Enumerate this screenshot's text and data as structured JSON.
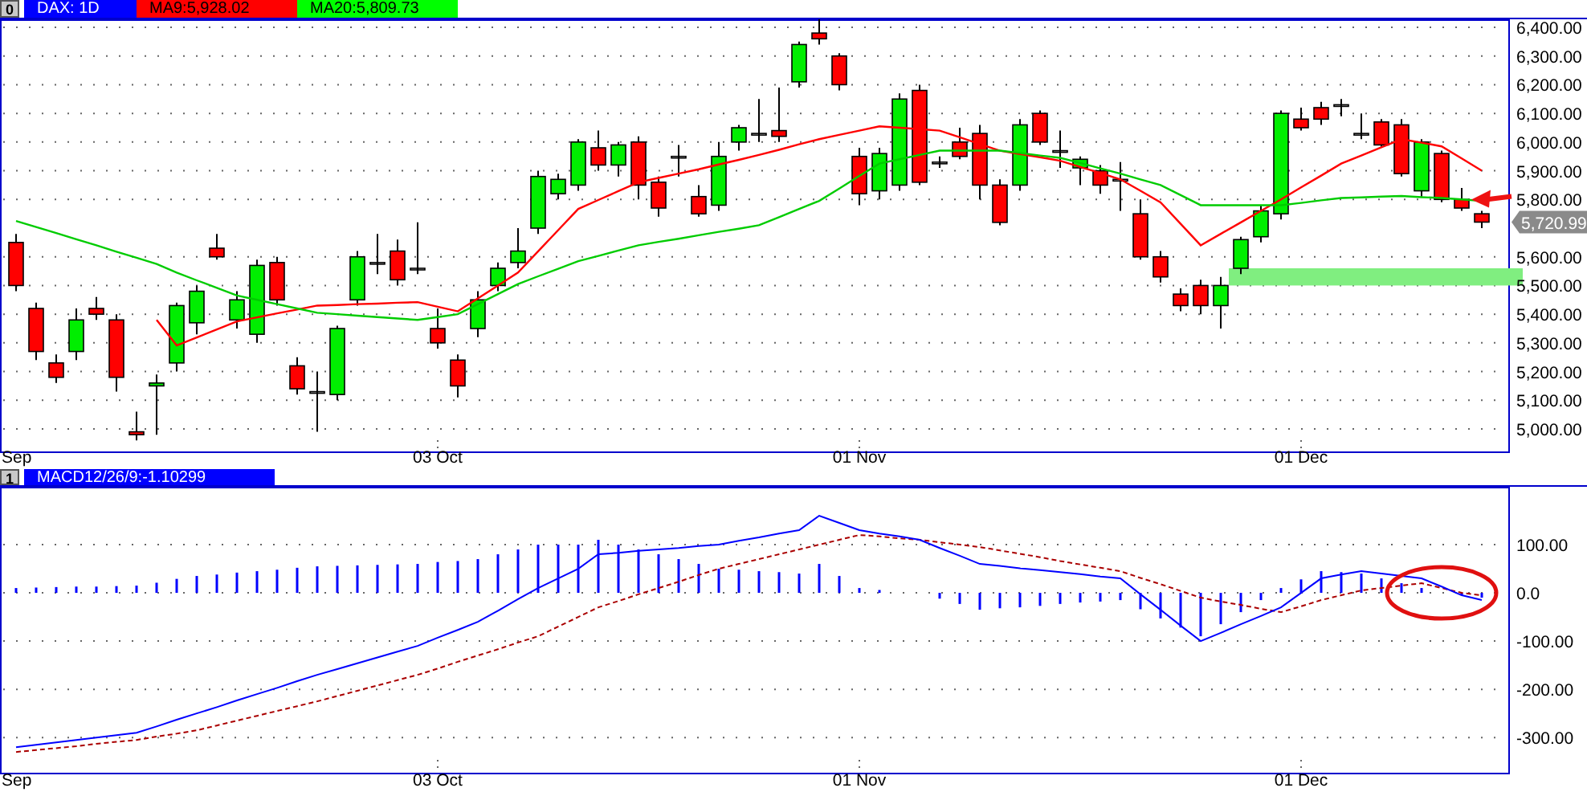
{
  "price_panel": {
    "index": "0",
    "legend": [
      {
        "label": "DAX: 1D",
        "color": "#0000ff"
      },
      {
        "label": "MA9:5,928.02",
        "color": "#ff0000"
      },
      {
        "label": "MA20:5,809.73",
        "color": "#00ff00"
      }
    ],
    "chart_data": {
      "type": "candlestick",
      "categories": [
        "Sep",
        null,
        null,
        null,
        null,
        null,
        null,
        null,
        null,
        null,
        null,
        null,
        null,
        null,
        null,
        null,
        null,
        null,
        null,
        null,
        null,
        "03 Oct",
        null,
        null,
        null,
        null,
        null,
        null,
        null,
        null,
        null,
        null,
        null,
        null,
        null,
        null,
        null,
        null,
        null,
        null,
        null,
        null,
        "01 Nov",
        null,
        null,
        null,
        null,
        null,
        null,
        null,
        null,
        null,
        null,
        null,
        null,
        null,
        null,
        null,
        null,
        null,
        null,
        null,
        null,
        null,
        "01 Dec",
        null,
        null,
        null,
        null,
        null,
        null,
        null,
        null,
        null
      ],
      "ylim": [
        4916,
        6428
      ],
      "grid": true,
      "yticks": [
        {
          "value": 6400,
          "label": "6,400.00"
        },
        {
          "value": 6300,
          "label": "6,300.00"
        },
        {
          "value": 6200,
          "label": "6,200.00"
        },
        {
          "value": 6100,
          "label": "6,100.00"
        },
        {
          "value": 6000,
          "label": "6,000.00"
        },
        {
          "value": 5900,
          "label": "5,900.00"
        },
        {
          "value": 5800,
          "label": "5,800.00"
        },
        {
          "value": 5600,
          "label": "5,600.00"
        },
        {
          "value": 5500,
          "label": "5,500.00"
        },
        {
          "value": 5400,
          "label": "5,400.00"
        },
        {
          "value": 5300,
          "label": "5,300.00"
        },
        {
          "value": 5200,
          "label": "5,200.00"
        },
        {
          "value": 5100,
          "label": "5,100.00"
        },
        {
          "value": 5000,
          "label": "5,000.00"
        }
      ],
      "ohlc": [
        [
          5650,
          5680,
          5480,
          5500
        ],
        [
          5420,
          5440,
          5240,
          5270
        ],
        [
          5230,
          5260,
          5160,
          5180
        ],
        [
          5270,
          5420,
          5240,
          5380
        ],
        [
          5420,
          5460,
          5380,
          5400
        ],
        [
          5380,
          5400,
          5130,
          5180
        ],
        [
          4990,
          5060,
          4960,
          4980
        ],
        [
          5150,
          5190,
          4980,
          5160
        ],
        [
          5230,
          5440,
          5200,
          5430
        ],
        [
          5370,
          5500,
          5330,
          5480
        ],
        [
          5630,
          5680,
          5590,
          5600
        ],
        [
          5380,
          5480,
          5350,
          5450
        ],
        [
          5330,
          5590,
          5300,
          5570
        ],
        [
          5580,
          5600,
          5430,
          5450
        ],
        [
          5220,
          5250,
          5120,
          5140
        ],
        [
          5130,
          5200,
          4990,
          5130
        ],
        [
          5120,
          5360,
          5100,
          5350
        ],
        [
          5450,
          5620,
          5430,
          5600
        ],
        [
          5580,
          5680,
          5540,
          5580
        ],
        [
          5620,
          5660,
          5500,
          5520
        ],
        [
          5560,
          5720,
          5540,
          5560
        ],
        [
          5350,
          5420,
          5280,
          5300
        ],
        [
          5240,
          5260,
          5110,
          5150
        ],
        [
          5350,
          5480,
          5320,
          5450
        ],
        [
          5500,
          5580,
          5480,
          5560
        ],
        [
          5580,
          5700,
          5560,
          5620
        ],
        [
          5700,
          5900,
          5680,
          5880
        ],
        [
          5820,
          5890,
          5800,
          5870
        ],
        [
          5850,
          6010,
          5830,
          6000
        ],
        [
          5980,
          6040,
          5900,
          5920
        ],
        [
          5920,
          6000,
          5880,
          5990
        ],
        [
          6000,
          6020,
          5800,
          5850
        ],
        [
          5860,
          5880,
          5740,
          5770
        ],
        [
          5950,
          5990,
          5880,
          5950
        ],
        [
          5810,
          5850,
          5740,
          5750
        ],
        [
          5780,
          6000,
          5760,
          5950
        ],
        [
          6000,
          6060,
          5970,
          6050
        ],
        [
          6030,
          6150,
          6000,
          6030
        ],
        [
          6040,
          6190,
          6000,
          6020
        ],
        [
          6210,
          6350,
          6190,
          6340
        ],
        [
          6380,
          6430,
          6340,
          6360
        ],
        [
          6300,
          6310,
          6180,
          6200
        ],
        [
          5950,
          5980,
          5780,
          5820
        ],
        [
          5830,
          5980,
          5800,
          5960
        ],
        [
          5850,
          6170,
          5830,
          6150
        ],
        [
          6180,
          6200,
          5850,
          5860
        ],
        [
          5930,
          5950,
          5910,
          5930
        ],
        [
          6000,
          6050,
          5940,
          5950
        ],
        [
          6030,
          6060,
          5800,
          5850
        ],
        [
          5850,
          5870,
          5710,
          5720
        ],
        [
          5850,
          6080,
          5830,
          6060
        ],
        [
          6100,
          6110,
          5990,
          6000
        ],
        [
          5970,
          6040,
          5910,
          5970
        ],
        [
          5910,
          5950,
          5850,
          5940
        ],
        [
          5900,
          5920,
          5820,
          5850
        ],
        [
          5870,
          5930,
          5760,
          5870
        ],
        [
          5750,
          5800,
          5590,
          5600
        ],
        [
          5600,
          5620,
          5510,
          5530
        ],
        [
          5470,
          5490,
          5410,
          5430
        ],
        [
          5500,
          5520,
          5400,
          5430
        ],
        [
          5430,
          5530,
          5350,
          5500
        ],
        [
          5560,
          5670,
          5540,
          5660
        ],
        [
          5670,
          5780,
          5650,
          5760
        ],
        [
          5750,
          6110,
          5730,
          6100
        ],
        [
          6080,
          6120,
          6040,
          6050
        ],
        [
          6120,
          6140,
          6060,
          6080
        ],
        [
          6130,
          6150,
          6090,
          6130
        ],
        [
          6030,
          6100,
          6010,
          6030
        ],
        [
          6070,
          6080,
          5980,
          5990
        ],
        [
          6060,
          6080,
          5880,
          5890
        ],
        [
          5830,
          6010,
          5810,
          6000
        ],
        [
          5960,
          5970,
          5790,
          5800
        ],
        [
          5800,
          5840,
          5760,
          5770
        ],
        [
          5750,
          5760,
          5700,
          5720.99
        ]
      ],
      "series": [
        {
          "type": "line",
          "color": "#ff0000",
          "values": [
            null,
            null,
            null,
            null,
            null,
            null,
            null,
            5380,
            5291,
            5319,
            5347,
            5375,
            5389,
            5403,
            5416,
            5430,
            5432,
            5435,
            5437,
            5440,
            5442,
            5426,
            5410,
            5455,
            5500,
            5545,
            5619,
            5693,
            5767,
            5798,
            5829,
            5860,
            5875,
            5890,
            5905,
            5922,
            5938,
            5955,
            5973,
            5992,
            6010,
            6025,
            6040,
            6055,
            6050,
            6045,
            6040,
            6017,
            5993,
            5970,
            5958,
            5947,
            5935,
            5913,
            5892,
            5870,
            5830,
            5790,
            5715,
            5640,
            5680,
            5720,
            5760,
            5800,
            5842,
            5883,
            5925,
            5953,
            5982,
            6010,
            5998,
            5985,
            5943,
            5900
          ]
        },
        {
          "type": "line",
          "color": "#00cc00",
          "values": [
            5725,
            5704,
            5683,
            5661,
            5640,
            5618,
            5597,
            5575,
            5545,
            5518,
            5492,
            5465,
            5450,
            5435,
            5420,
            5405,
            5400,
            5395,
            5390,
            5385,
            5380,
            5390,
            5400,
            5435,
            5470,
            5505,
            5532,
            5558,
            5585,
            5603,
            5622,
            5640,
            5652,
            5663,
            5675,
            5687,
            5698,
            5710,
            5738,
            5767,
            5795,
            5838,
            5882,
            5925,
            5940,
            5955,
            5970,
            5970,
            5970,
            5970,
            5962,
            5953,
            5945,
            5927,
            5908,
            5890,
            5870,
            5850,
            5815,
            5780,
            5780,
            5780,
            5780,
            5780,
            5788,
            5797,
            5805,
            5807,
            5810,
            5812,
            5808,
            5805,
            5800,
            5795
          ]
        }
      ],
      "bands": [
        {
          "axis": "y",
          "from": 5500,
          "to": 5560
        }
      ],
      "annotations": [
        "5,720.99"
      ]
    }
  },
  "macd_panel": {
    "index": "1",
    "legend": [
      {
        "label": "MACD12/26/9:-1.10299",
        "color": "#0000ff"
      }
    ],
    "chart_data": {
      "type": "line",
      "categories": [
        "Sep",
        null,
        null,
        null,
        null,
        null,
        null,
        null,
        null,
        null,
        null,
        null,
        null,
        null,
        null,
        null,
        null,
        null,
        null,
        null,
        null,
        "03 Oct",
        null,
        null,
        null,
        null,
        null,
        null,
        null,
        null,
        null,
        null,
        null,
        null,
        null,
        null,
        null,
        null,
        null,
        null,
        null,
        null,
        "01 Nov",
        null,
        null,
        null,
        null,
        null,
        null,
        null,
        null,
        null,
        null,
        null,
        null,
        null,
        null,
        null,
        null,
        null,
        null,
        null,
        null,
        null,
        "01 Dec",
        null,
        null,
        null,
        null,
        null,
        null,
        null,
        null,
        null
      ],
      "ylim": [
        -373,
        220
      ],
      "grid": true,
      "yticks": [
        {
          "value": 100,
          "label": "100.00"
        },
        {
          "value": 0,
          "label": "0.0"
        },
        {
          "value": -100,
          "label": "-100.00"
        },
        {
          "value": -200,
          "label": "-200.00"
        },
        {
          "value": -300,
          "label": "-300.00"
        }
      ],
      "series": [
        {
          "color": "#0000ff",
          "values": [
            -320,
            -315,
            -310,
            -305,
            -300,
            -295,
            -290,
            -277,
            -263,
            -250,
            -237,
            -223,
            -210,
            -197,
            -183,
            -170,
            -158,
            -146,
            -134,
            -122,
            -110,
            -93,
            -77,
            -60,
            -37,
            -13,
            10,
            30,
            50,
            80,
            83,
            87,
            90,
            93,
            97,
            100,
            108,
            115,
            123,
            130,
            160,
            145,
            130,
            123,
            117,
            110,
            93,
            77,
            60,
            56,
            51,
            47,
            43,
            39,
            34,
            30,
            -3,
            -35,
            -68,
            -100,
            -83,
            -65,
            -48,
            -30,
            0,
            30,
            38,
            45,
            40,
            35,
            30,
            13,
            -5,
            -15
          ]
        },
        {
          "color": "#aa0000",
          "line_style": "dashed",
          "values": [
            -330,
            -326,
            -322,
            -318,
            -313,
            -309,
            -305,
            -298,
            -292,
            -285,
            -275,
            -265,
            -255,
            -245,
            -235,
            -225,
            -214,
            -203,
            -192,
            -181,
            -170,
            -157,
            -143,
            -130,
            -117,
            -103,
            -90,
            -70,
            -50,
            -30,
            -17,
            -3,
            10,
            23,
            37,
            50,
            60,
            70,
            80,
            90,
            100,
            110,
            120,
            117,
            113,
            110,
            105,
            100,
            95,
            88,
            81,
            74,
            66,
            59,
            52,
            45,
            31,
            18,
            4,
            -10,
            -18,
            -25,
            -33,
            -40,
            -28,
            -15,
            -5,
            5,
            10,
            15,
            20,
            10,
            0,
            -5
          ]
        }
      ]
    }
  }
}
